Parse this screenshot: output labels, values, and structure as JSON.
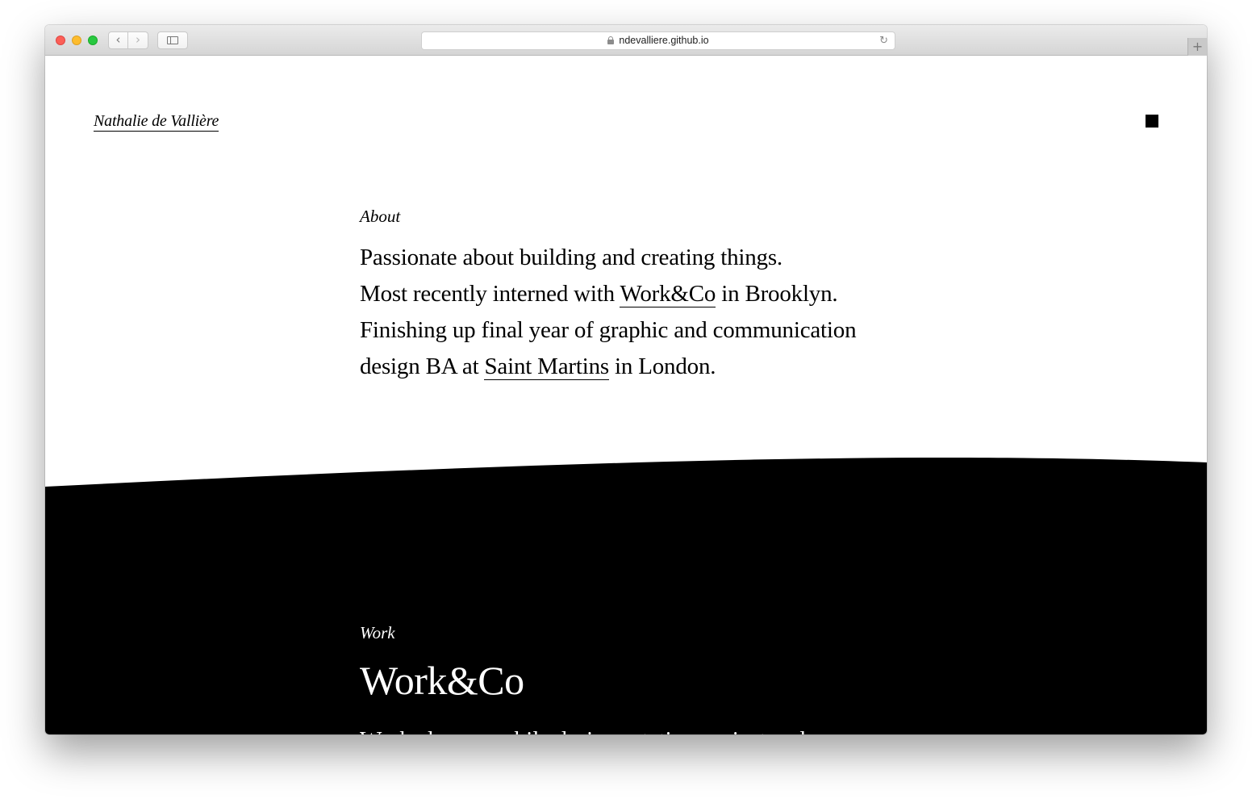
{
  "browser": {
    "url": "ndevalliere.github.io",
    "new_tab_label": "+",
    "back_glyph": "‹",
    "forward_glyph": "›",
    "reload_glyph": "↻"
  },
  "site": {
    "name": "Nathalie de Vallière",
    "menu_icon": "square-menu-icon"
  },
  "about": {
    "label": "About",
    "line1": "Passionate about building and creating things.",
    "line2_before": "Most recently interned with ",
    "line2_link": "Work&Co",
    "line2_after": " in Brooklyn.",
    "line3": "Finishing up final year of graphic and communication",
    "line4_before": "design BA at ",
    "line4_link": "Saint Martins",
    "line4_after": " in London."
  },
  "work": {
    "label": "Work",
    "title": "Work&Co",
    "description": "Worked on a mobile design rotating project and a"
  },
  "colors": {
    "background": "#ffffff",
    "wave": "#000000",
    "text": "#000000"
  }
}
